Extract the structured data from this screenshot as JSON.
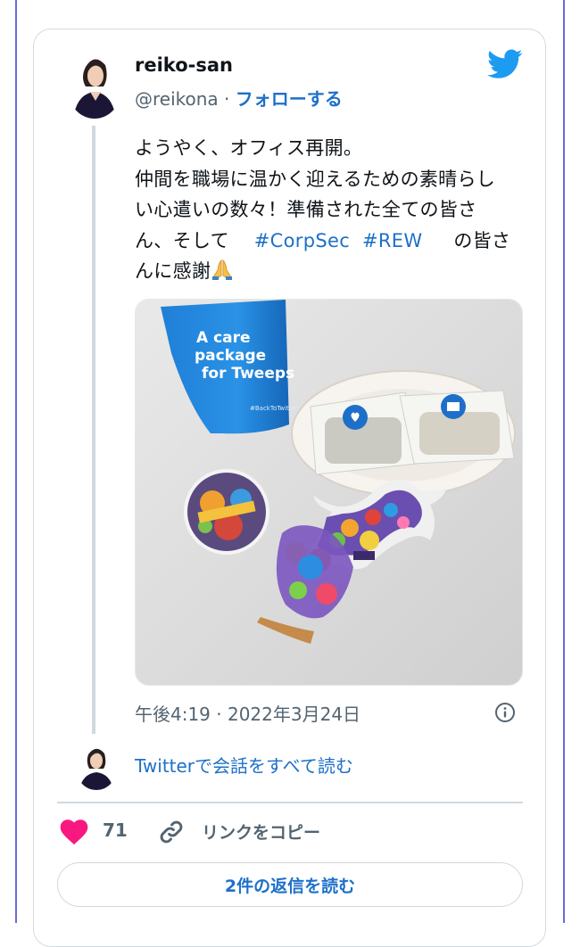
{
  "tweet": {
    "user": {
      "name": "reiko-san",
      "handle": "@reikona",
      "separator": "·",
      "follow_label": "フォローする"
    },
    "text_lines": [
      "ようやく、オフィス再開。",
      "仲間を職場に温かく迎えるための素晴らし",
      "い心遣いの数々！準備された全ての皆さ"
    ],
    "line4_prefix": "ん、そして",
    "hashtags": [
      "#CorpSec",
      "#REW"
    ],
    "line4_suffix": "の皆さ",
    "line5": "んに感謝",
    "emoji_name": "folded-hands-icon",
    "photo": {
      "bag_text_lines": [
        "A care",
        "package",
        "for Tweeps"
      ],
      "bag_tag": "#BackToTwitter"
    },
    "timestamp": "午後4:19 · 2022年3月24日",
    "conversation_link": "Twitterで会話をすべて読む",
    "actions": {
      "like_count": "71",
      "copy_link_label": "リンクをコピー"
    },
    "replies_button": "2件の返信を読む"
  },
  "colors": {
    "accent": "#1d70c9",
    "twitter_blue": "#1d9bf0",
    "like": "#f91880",
    "secondary_text": "#536471",
    "border": "#cfd9de"
  }
}
